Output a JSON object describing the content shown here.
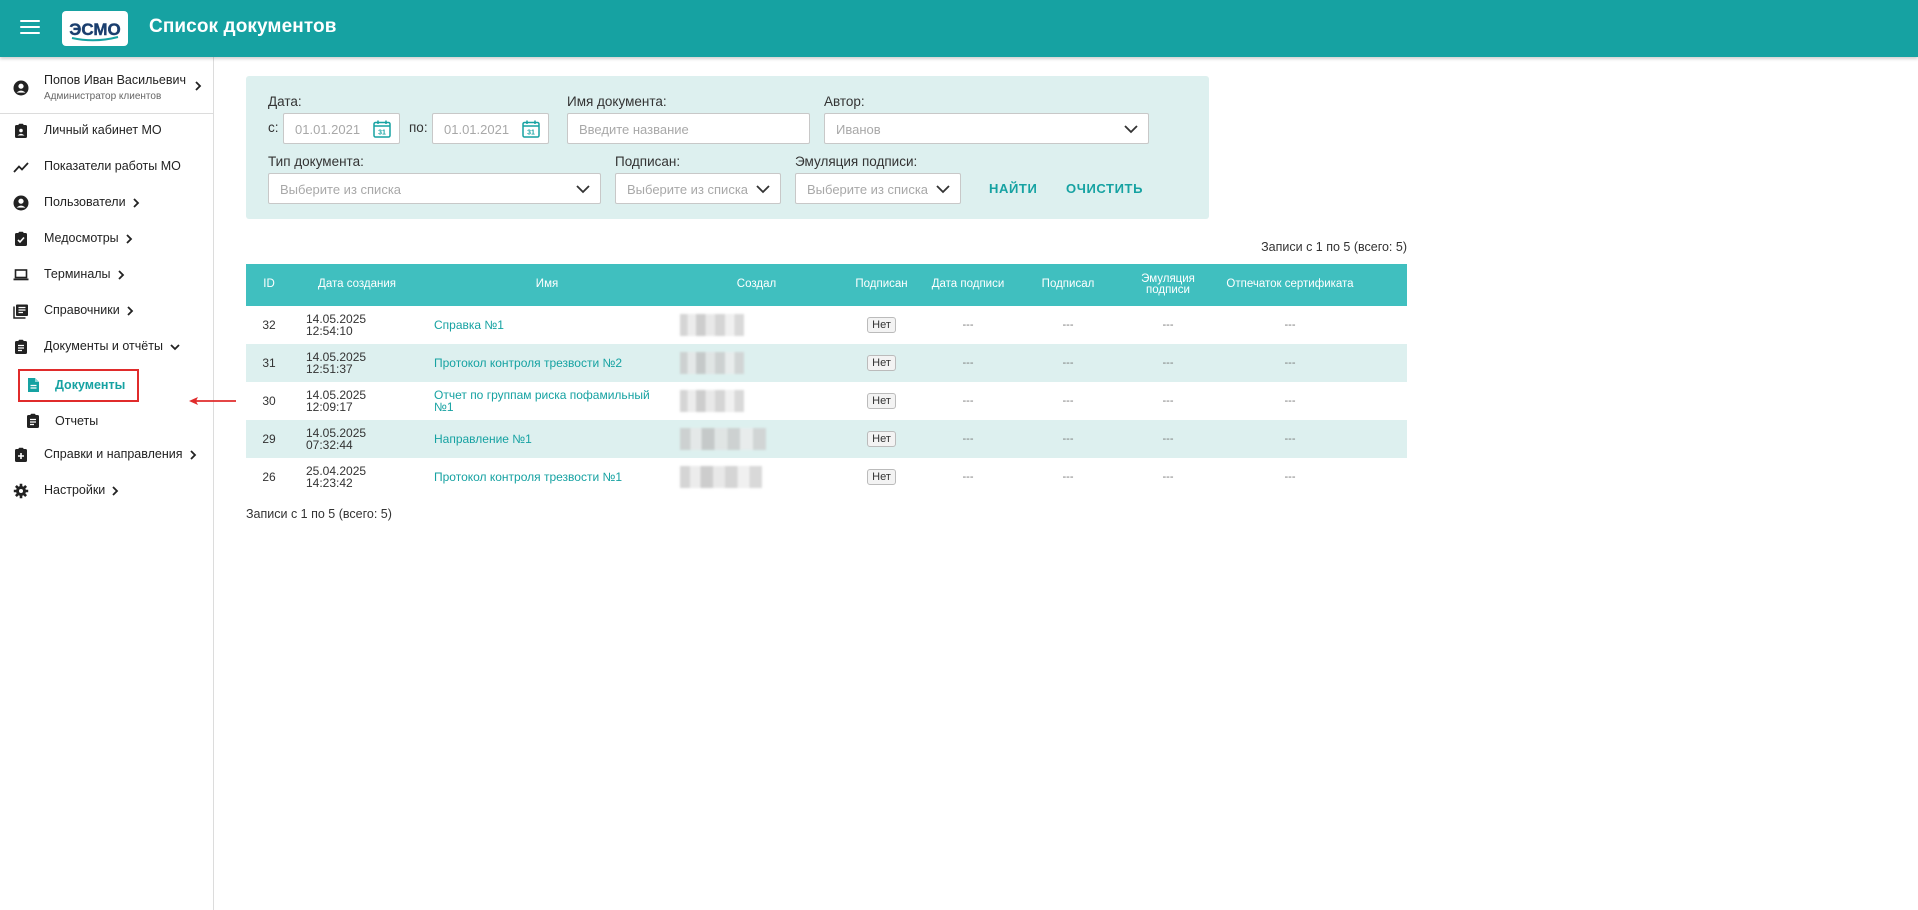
{
  "header": {
    "title": "Список документов",
    "logo_text": "ЭСМО",
    "brand_color": "#16a2a2"
  },
  "sidebar": {
    "user": {
      "name": "Попов Иван Васильевич",
      "role": "Администратор клиентов"
    },
    "items": [
      {
        "label": "Личный кабинет МО",
        "icon": "badge-icon"
      },
      {
        "label": "Показатели работы МО",
        "icon": "chart-line-icon"
      },
      {
        "label": "Пользователи",
        "icon": "user-circle-icon"
      },
      {
        "label": "Медосмотры",
        "icon": "clipboard-icon"
      },
      {
        "label": "Терминалы",
        "icon": "laptop-icon"
      },
      {
        "label": "Справочники",
        "icon": "book-list-icon"
      },
      {
        "label": "Документы и отчёты",
        "icon": "clipboard-list-icon"
      },
      {
        "label": "Справки и направления",
        "icon": "clipboard-plus-icon"
      },
      {
        "label": "Настройки",
        "icon": "gear-icon"
      }
    ],
    "sub_items": [
      {
        "label": "Документы",
        "icon": "document-icon",
        "active": true
      },
      {
        "label": "Отчеты",
        "icon": "clipboard-icon",
        "active": false
      }
    ]
  },
  "filters": {
    "date_label": "Дата:",
    "from_label": "с:",
    "from_placeholder": "01.01.2021",
    "to_label": "по:",
    "to_placeholder": "01.01.2021",
    "doc_name_label": "Имя документа:",
    "doc_name_placeholder": "Введите название",
    "author_label": "Автор:",
    "author_placeholder": "Иванов",
    "doc_type_label": "Тип документа:",
    "doc_type_placeholder": "Выберите из списка",
    "signed_label": "Подписан:",
    "signed_placeholder": "Выберите из списка",
    "emulation_label": "Эмуляция подписи:",
    "emulation_placeholder": "Выберите из списка",
    "find_button": "НАЙТИ",
    "clear_button": "ОЧИСТИТЬ"
  },
  "records_info": "Записи с 1 по 5 (всего: 5)",
  "table": {
    "columns": [
      "ID",
      "Дата создания",
      "Имя",
      "Создал",
      "Подписан",
      "Дата подписи",
      "Подписал",
      "Эмуляция подписи",
      "Отпечаток сертификата"
    ],
    "rows": [
      {
        "id": "32",
        "date": "14.05.2025",
        "time": "12:54:10",
        "name": "Справка №1",
        "signed": "Нет",
        "sign_date": "---",
        "signer": "---",
        "emulation": "---",
        "fingerprint": "---"
      },
      {
        "id": "31",
        "date": "14.05.2025",
        "time": "12:51:37",
        "name": "Протокол контроля трезвости №2",
        "signed": "Нет",
        "sign_date": "---",
        "signer": "---",
        "emulation": "---",
        "fingerprint": "---"
      },
      {
        "id": "30",
        "date": "14.05.2025",
        "time": "12:09:17",
        "name": "Отчет по группам риска пофамильный №1",
        "signed": "Нет",
        "sign_date": "---",
        "signer": "---",
        "emulation": "---",
        "fingerprint": "---"
      },
      {
        "id": "29",
        "date": "14.05.2025",
        "time": "07:32:44",
        "name": "Направление №1",
        "signed": "Нет",
        "sign_date": "---",
        "signer": "---",
        "emulation": "---",
        "fingerprint": "---"
      },
      {
        "id": "26",
        "date": "25.04.2025",
        "time": "14:23:42",
        "name": "Протокол контроля трезвости №1",
        "signed": "Нет",
        "sign_date": "---",
        "signer": "---",
        "emulation": "---",
        "fingerprint": "---"
      }
    ]
  }
}
